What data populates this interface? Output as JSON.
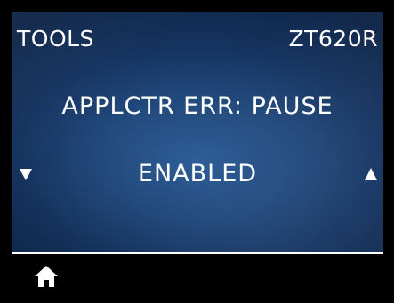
{
  "header": {
    "menu_title": "TOOLS",
    "model": "ZT620R"
  },
  "setting": {
    "name": "APPLCTR ERR: PAUSE",
    "value": "ENABLED"
  },
  "navigation": {
    "left_icon": "triangle-down-icon",
    "right_icon": "triangle-up-icon",
    "home_icon": "home-icon"
  },
  "colors": {
    "text": "#ffffff",
    "background": "#1f4a80",
    "bezel": "#000000"
  }
}
